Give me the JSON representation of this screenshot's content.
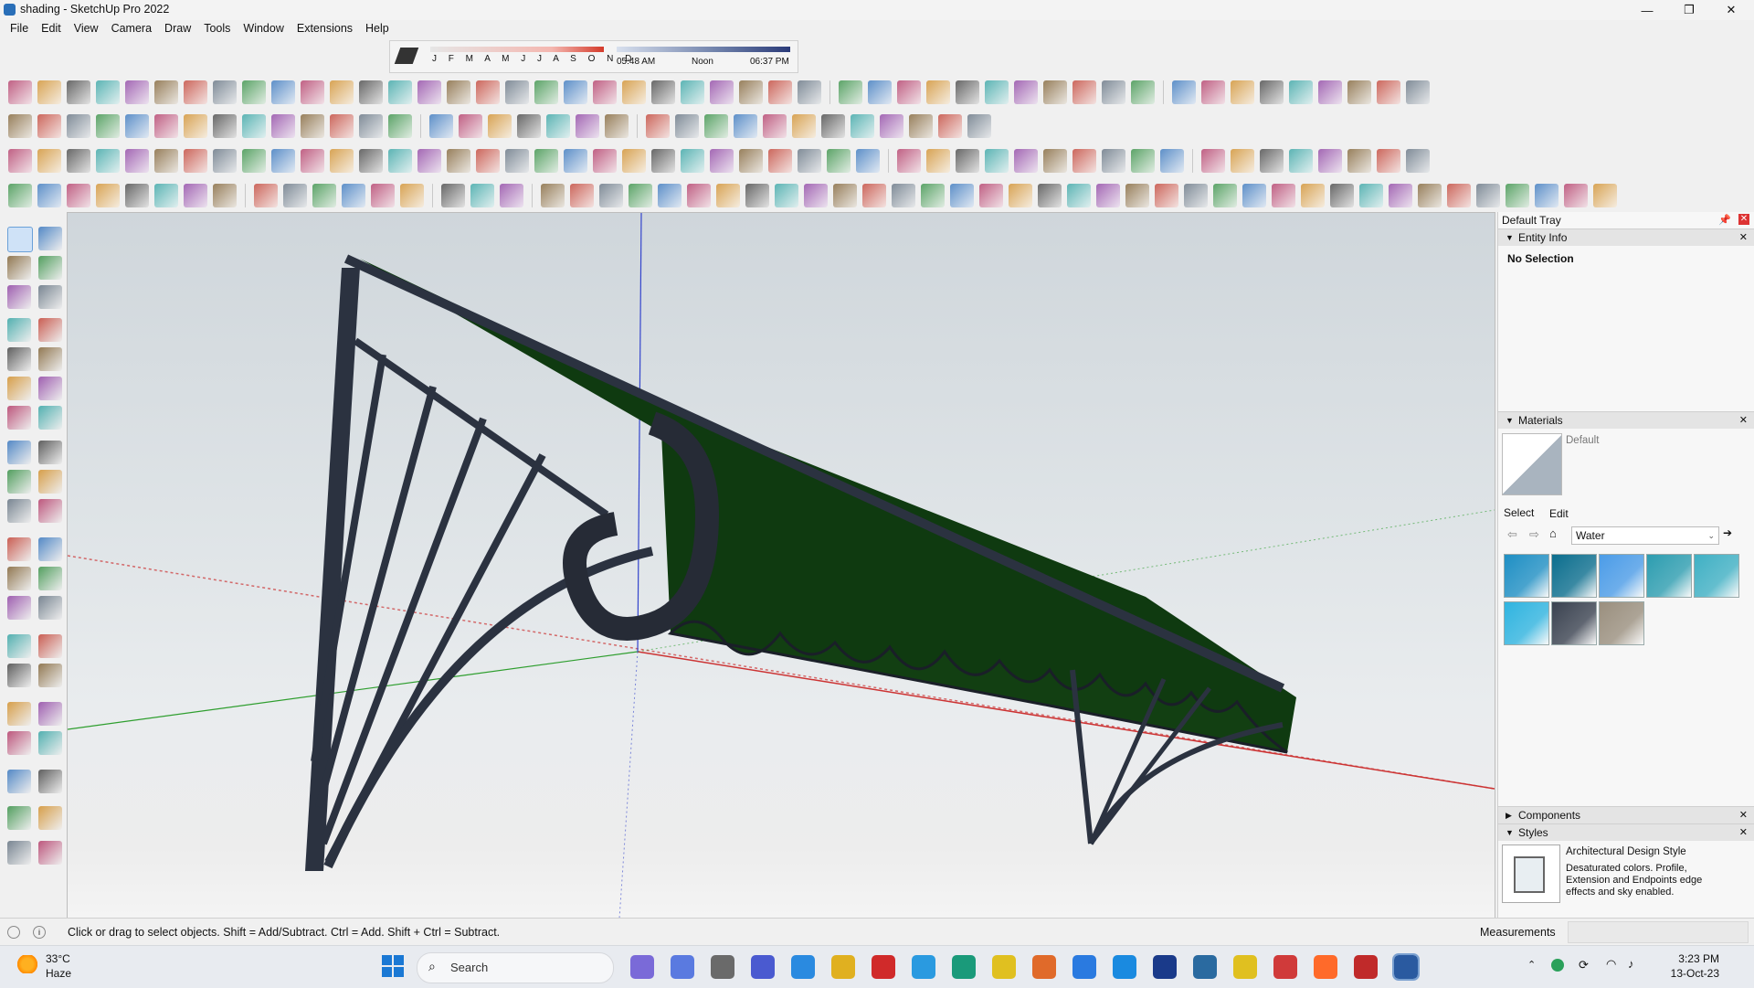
{
  "window": {
    "title": "shading - SketchUp Pro 2022",
    "minimize": "—",
    "maximize": "❐",
    "close": "✕"
  },
  "menu": [
    "File",
    "Edit",
    "View",
    "Camera",
    "Draw",
    "Tools",
    "Window",
    "Extensions",
    "Help"
  ],
  "shadow": {
    "months": "J F M A M J J A S O N D",
    "time_start": "05:48 AM",
    "time_mid": "Noon",
    "time_end": "06:37 PM"
  },
  "tray": {
    "title": "Default Tray",
    "entity_info": {
      "header": "Entity Info",
      "value": "No Selection"
    },
    "materials": {
      "header": "Materials",
      "current": "Default",
      "tab_select": "Select",
      "tab_edit": "Edit",
      "library": "Water",
      "swatches": [
        "#1e8fc4",
        "#0b6e8e",
        "#4b9ce8",
        "#2c9db0",
        "#3fb0c4",
        "#2fb4e0",
        "#3a4250",
        "#9a8f7e"
      ]
    },
    "components": {
      "header": "Components"
    },
    "styles": {
      "header": "Styles",
      "name": "Architectural Design Style",
      "description": "Desaturated colors. Profile, Extension and Endpoints edge effects and sky enabled."
    }
  },
  "status": {
    "message": "Click or drag to select objects. Shift = Add/Subtract. Ctrl = Add. Shift + Ctrl = Subtract.",
    "measurements_label": "Measurements",
    "measurements_value": ""
  },
  "taskbar": {
    "weather_temp": "33°C",
    "weather_desc": "Haze",
    "search_placeholder": "Search",
    "time": "3:23 PM",
    "date": "13-Oct-23"
  },
  "colors": {
    "canopy": "#0f3a10",
    "frame": "#2b3240",
    "axis_red": "#cc3333",
    "axis_green": "#2e9e2e",
    "axis_blue": "#3344cc"
  }
}
